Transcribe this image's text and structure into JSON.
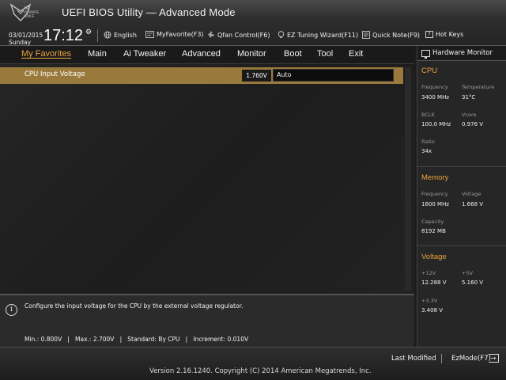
{
  "header": {
    "logo_text": [
      "THE",
      "ULTIMATE",
      "FORCE"
    ],
    "title": "UEFI BIOS Utility — Advanced Mode",
    "date": "03/01/2015",
    "day": "Sunday",
    "time": "17:12",
    "items": [
      {
        "label": "English",
        "icon": "globe-icon"
      },
      {
        "label": "MyFavorite(F3)",
        "icon": "favorite-icon"
      },
      {
        "label": "Qfan Control(F6)",
        "icon": "fan-icon"
      },
      {
        "label": "EZ Tuning Wizard(F11)",
        "icon": "bulb-icon"
      },
      {
        "label": "Quick Note(F9)",
        "icon": "note-icon"
      },
      {
        "label": "Hot Keys",
        "icon": "help-key-icon"
      }
    ]
  },
  "menu": {
    "tabs": [
      "My Favorites",
      "Main",
      "Ai Tweaker",
      "Advanced",
      "Monitor",
      "Boot",
      "Tool",
      "Exit"
    ],
    "active": "My Favorites"
  },
  "settings": [
    {
      "label": "CPU Input Voltage",
      "value": "1.760V",
      "input": "Auto"
    }
  ],
  "help": {
    "text": "Configure the input voltage for the CPU by the external voltage regulator.",
    "limits": "Min.: 0.800V   |   Max.: 2.700V   |   Standard: By CPU   |   Increment: 0.010V"
  },
  "hardware_monitor": {
    "title": "Hardware Monitor",
    "cpu": {
      "title": "CPU",
      "frequency_label": "Frequency",
      "frequency": "3400 MHz",
      "temperature_label": "Temperature",
      "temperature": "31°C",
      "bclk_label": "BCLK",
      "bclk": "100.0 MHz",
      "vcore_label": "Vcore",
      "vcore": "0.976 V",
      "ratio_label": "Ratio",
      "ratio": "34x"
    },
    "memory": {
      "title": "Memory",
      "frequency_label": "Frequency",
      "frequency": "1600 MHz",
      "voltage_label": "Voltage",
      "voltage": "1.668 V",
      "capacity_label": "Capacity",
      "capacity": "8192 MB"
    },
    "voltage": {
      "title": "Voltage",
      "v12_label": "+12V",
      "v12": "12.288 V",
      "v5_label": "+5V",
      "v5": "5.160 V",
      "v33_label": "+3.3V",
      "v33": "3.408 V"
    }
  },
  "footer": {
    "last_modified": "Last Modified",
    "ezmode": "EzMode(F7)",
    "version": "Version 2.16.1240. Copyright (C) 2014 American Megatrends, Inc."
  },
  "colors": {
    "accent": "#e8a33d",
    "highlight_row": "#9a7a3c",
    "background": "#1c1c1c"
  }
}
